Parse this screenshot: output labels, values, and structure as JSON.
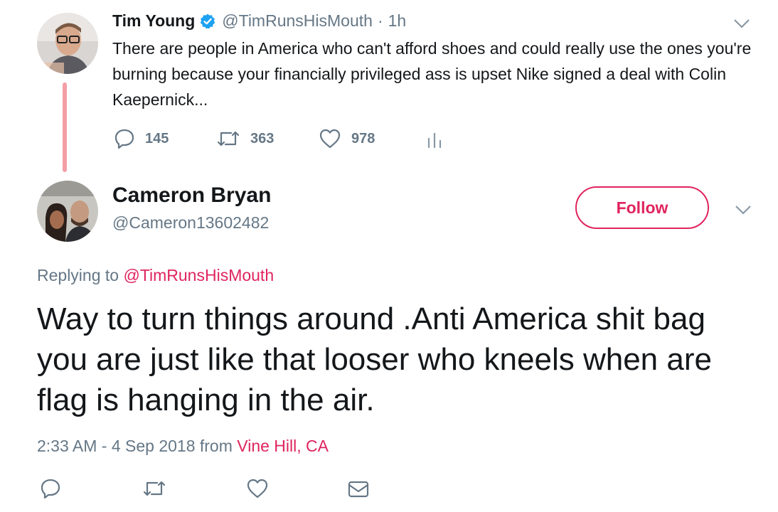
{
  "parent_tweet": {
    "display_name": "Tim Young",
    "handle": "@TimRunsHisMouth",
    "separator": "·",
    "time": "1h",
    "text": "There are people in America who can't afford shoes and could really use the ones you're burning because your financially privileged ass is upset Nike signed a deal with Colin Kaepernick...",
    "replies": "145",
    "retweets": "363",
    "likes": "978",
    "verified_icon": "verified-badge-icon",
    "colors": {
      "verified": "#1da1f2"
    }
  },
  "reply_tweet": {
    "display_name": "Cameron Bryan",
    "handle": "@Cameron13602482",
    "follow_label": "Follow",
    "replying_prefix": "Replying to",
    "replying_handle": "@TimRunsHisMouth",
    "text": "Way to turn things around .Anti America shit bag you are just like that looser who kneels when are flag is hanging in the air.",
    "timestamp": "2:33 AM - 4 Sep 2018 from",
    "location": "Vine Hill, CA"
  },
  "colors": {
    "accent": "#e0245e",
    "thread_line": "#f39ea6",
    "muted": "#657786",
    "text": "#14171a"
  }
}
